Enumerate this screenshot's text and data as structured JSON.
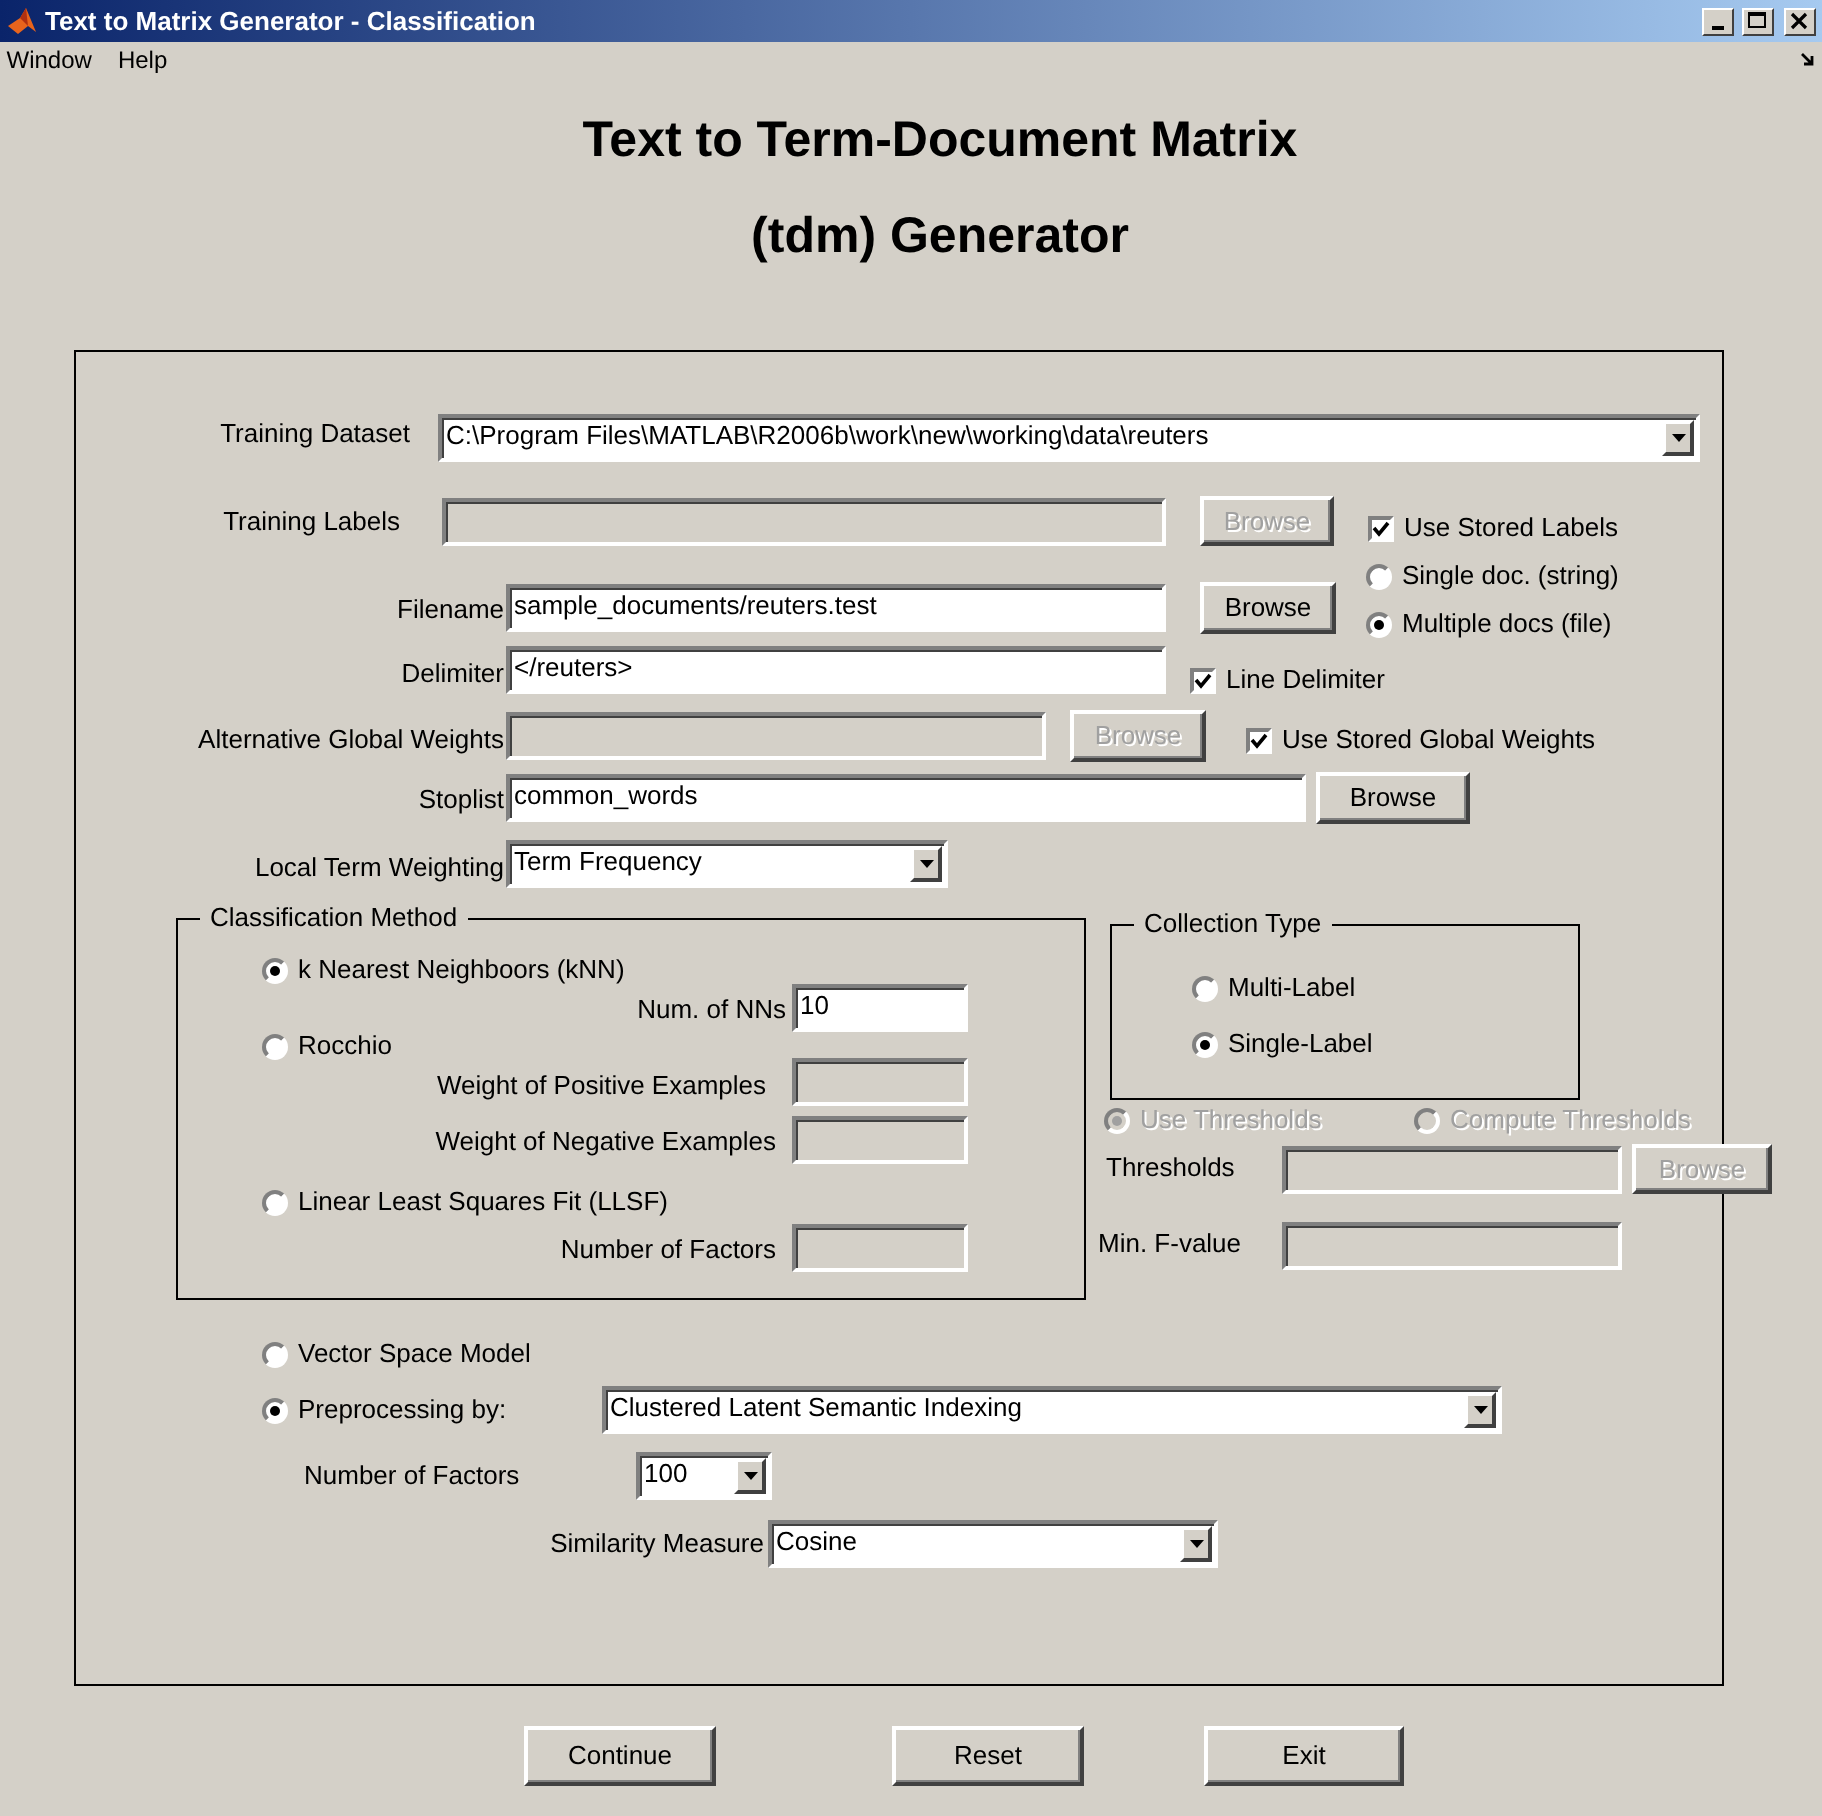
{
  "window": {
    "title": "Text to Matrix Generator - Classification"
  },
  "menu": [
    {
      "label": "Window"
    },
    {
      "label": "Help"
    }
  ],
  "heading": [
    "Text to Term-Document Matrix",
    "(tdm) Generator"
  ],
  "controls": [
    {
      "kind": "label",
      "text": "Training Dataset"
    },
    {
      "kind": "popup",
      "value": "C:\\Program Files\\MATLAB\\R2006b\\work\\new\\working\\data\\reuters"
    },
    {
      "kind": "label",
      "text": "Training Labels"
    },
    {
      "kind": "edit",
      "disabled": true
    },
    {
      "kind": "button",
      "label": "Browse",
      "disabled": true
    },
    {
      "kind": "checkbox",
      "label": "Use Stored Labels",
      "checked": true
    },
    {
      "kind": "label",
      "text": "Filename"
    },
    {
      "kind": "edit",
      "value": "sample_documents/reuters.test",
      "disabled": false
    },
    {
      "kind": "button",
      "label": "Browse",
      "disabled": false
    },
    {
      "kind": "radio",
      "label": "Single doc. (string)",
      "selected": false,
      "disabled": false
    },
    {
      "kind": "radio",
      "label": "Multiple docs (file)",
      "selected": true,
      "disabled": false
    },
    {
      "kind": "label",
      "text": "Delimiter"
    },
    {
      "kind": "edit",
      "value": "</reuters>",
      "disabled": false
    },
    {
      "kind": "checkbox",
      "label": "Line Delimiter",
      "checked": true
    },
    {
      "kind": "label",
      "text": "Alternative Global Weights"
    },
    {
      "kind": "edit",
      "disabled": true
    },
    {
      "kind": "button",
      "label": "Browse",
      "disabled": true
    },
    {
      "kind": "checkbox",
      "label": "Use Stored Global Weights",
      "checked": true
    },
    {
      "kind": "label",
      "text": "Stoplist"
    },
    {
      "kind": "edit",
      "value": "common_words",
      "disabled": false
    },
    {
      "kind": "button",
      "label": "Browse",
      "disabled": false
    },
    {
      "kind": "label",
      "text": "Local Term Weighting"
    },
    {
      "kind": "popup",
      "value": "Term Frequency"
    },
    {
      "kind": "frame",
      "title": "Classification Method"
    },
    {
      "kind": "radio",
      "label": "k Nearest Neighboors (kNN)",
      "selected": true,
      "disabled": false
    },
    {
      "kind": "label",
      "text": "Num. of NNs"
    },
    {
      "kind": "edit",
      "value": "10",
      "disabled": false
    },
    {
      "kind": "radio",
      "label": "Rocchio",
      "selected": false,
      "disabled": false
    },
    {
      "kind": "label",
      "text": "Weight of Positive Examples"
    },
    {
      "kind": "edit",
      "disabled": true
    },
    {
      "kind": "label",
      "text": "Weight of Negative Examples"
    },
    {
      "kind": "edit",
      "disabled": true
    },
    {
      "kind": "radio",
      "label": "Linear Least Squares Fit (LLSF)",
      "selected": false,
      "disabled": false
    },
    {
      "kind": "label",
      "text": "Number of Factors"
    },
    {
      "kind": "edit",
      "disabled": true
    },
    {
      "kind": "frame",
      "title": "Collection Type"
    },
    {
      "kind": "radio",
      "label": "Multi-Label",
      "selected": false,
      "disabled": false
    },
    {
      "kind": "radio",
      "label": "Single-Label",
      "selected": true,
      "disabled": false
    },
    {
      "kind": "radio",
      "label": "Use Thresholds",
      "selected": true,
      "disabled": true
    },
    {
      "kind": "radio",
      "label": "Compute Thresholds",
      "selected": false,
      "disabled": true
    },
    {
      "kind": "label",
      "text": "Thresholds"
    },
    {
      "kind": "edit",
      "disabled": true
    },
    {
      "kind": "button",
      "label": "Browse",
      "disabled": true
    },
    {
      "kind": "label",
      "text": "Min. F-value"
    },
    {
      "kind": "edit",
      "disabled": true
    },
    {
      "kind": "radio",
      "label": "Vector Space Model",
      "selected": false,
      "disabled": false
    },
    {
      "kind": "radio",
      "label": "Preprocessing by:",
      "selected": true,
      "disabled": false
    },
    {
      "kind": "popup",
      "value": "Clustered Latent Semantic Indexing"
    },
    {
      "kind": "label",
      "text": "Number of Factors"
    },
    {
      "kind": "popup",
      "value": "100"
    },
    {
      "kind": "label",
      "text": "Similarity Measure"
    },
    {
      "kind": "popup",
      "value": "Cosine"
    }
  ],
  "buttons": [
    {
      "label": "Continue"
    },
    {
      "label": "Reset"
    },
    {
      "label": "Exit"
    }
  ]
}
